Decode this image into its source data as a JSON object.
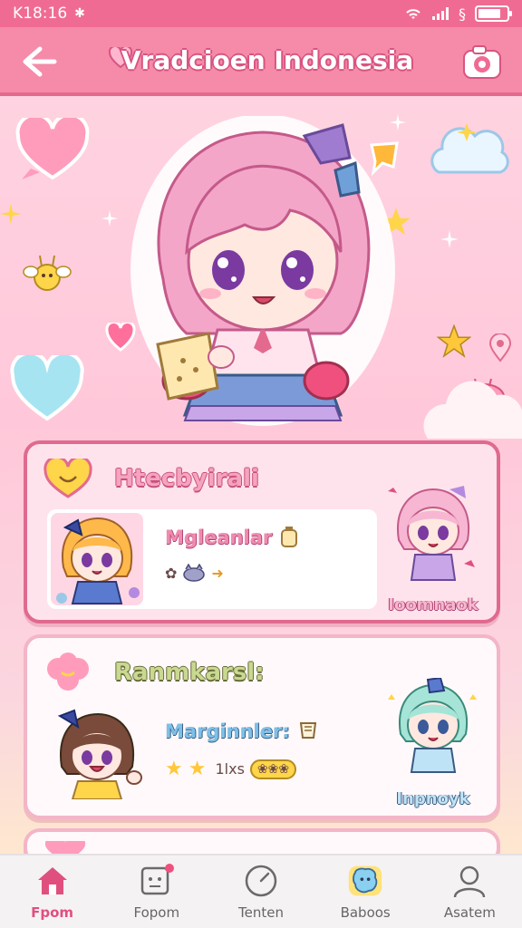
{
  "status_bar": {
    "time": "K18:16",
    "notification_icon": "gear-icon",
    "battery_level": 0.8
  },
  "app_bar": {
    "title": "Vradcioen Indonesia",
    "back_icon": "arrow-left-icon",
    "camera_icon": "camera-icon"
  },
  "cards": [
    {
      "title": "Htecbyirali",
      "item_name": "Mgleanlar",
      "side_label": "Ioomnaok"
    },
    {
      "title": "Ranmkarsl:",
      "item_name": "Marginnler:",
      "rating_text": "1lxs",
      "side_label": "Inpnoyk"
    }
  ],
  "bottom_nav": {
    "items": [
      {
        "label": "Fpom",
        "icon": "home-icon",
        "active": true
      },
      {
        "label": "Fopom",
        "icon": "chat-icon",
        "active": false
      },
      {
        "label": "Tenten",
        "icon": "clock-icon",
        "active": false
      },
      {
        "label": "Baboos",
        "icon": "face-icon",
        "active": false
      },
      {
        "label": "Asatem",
        "icon": "person-icon",
        "active": false
      }
    ]
  },
  "colors": {
    "accent": "#f06b93",
    "app_bar": "#f58aa9",
    "background": "#ffc8da",
    "active_nav": "#e0507e"
  }
}
